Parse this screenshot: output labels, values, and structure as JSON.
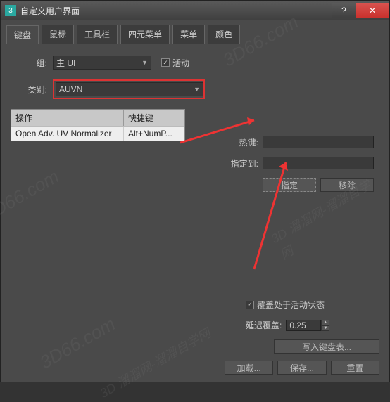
{
  "window": {
    "title": "自定义用户界面"
  },
  "tabs": [
    "键盘",
    "鼠标",
    "工具栏",
    "四元菜单",
    "菜单",
    "颜色"
  ],
  "active_tab": 0,
  "group": {
    "label": "组:",
    "value": "主 UI"
  },
  "active_checkbox": {
    "label": "活动",
    "checked": true
  },
  "category": {
    "label": "类别:",
    "value": "AUVN"
  },
  "table": {
    "headers": {
      "op": "操作",
      "hk": "快捷键"
    },
    "rows": [
      {
        "op": "Open Adv. UV Normalizer",
        "hk": "Alt+NumP..."
      }
    ]
  },
  "hotkey": {
    "label": "热键:",
    "value": ""
  },
  "assign_to": {
    "label": "指定到:",
    "value": ""
  },
  "buttons": {
    "assign": "指定",
    "remove": "移除"
  },
  "cover_active": {
    "label": "覆盖处于活动状态",
    "checked": true
  },
  "delay_cover": {
    "label": "延迟覆盖:",
    "value": "0.25"
  },
  "write_table": "写入键盘表...",
  "bottom_buttons": {
    "load": "加载...",
    "save": "保存...",
    "reset": "重置"
  },
  "watermarks": [
    "3D66.com",
    "3D66.com",
    "3D 溜溜网-溜溜自学网",
    "3D66.com",
    "3D 溜溜网-溜溜自学网"
  ]
}
